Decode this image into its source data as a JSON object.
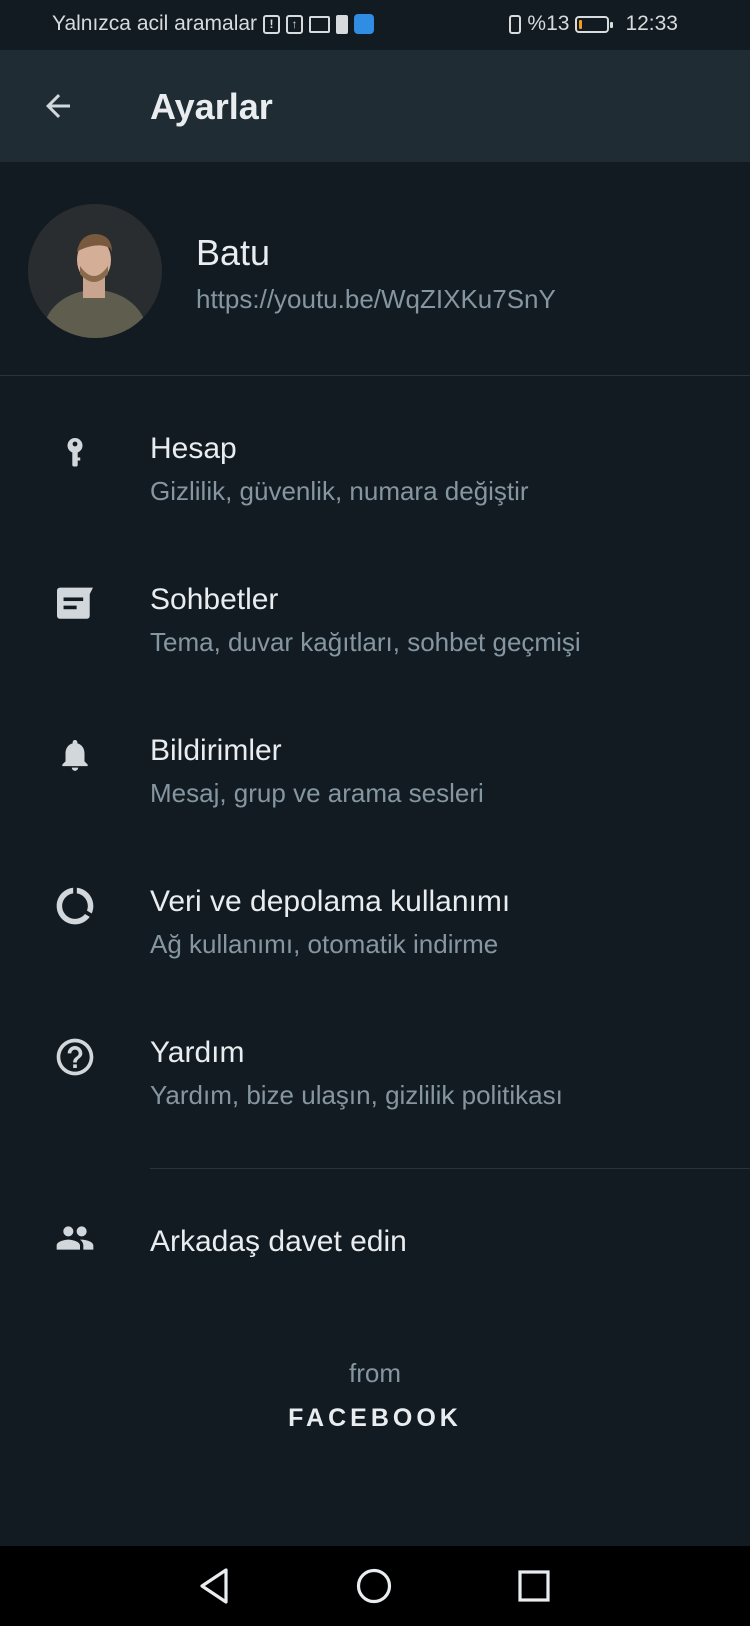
{
  "status_bar": {
    "carrier_text": "Yalnızca acil aramalar",
    "battery_text": "%13",
    "battery_level": 0.13,
    "time": "12:33",
    "icons": [
      "alert-icon",
      "upload-icon",
      "mail-icon",
      "battery-saver-icon",
      "app-notification-icon",
      "vibrate-icon",
      "battery-icon"
    ]
  },
  "header": {
    "title": "Ayarlar",
    "back_icon": "arrow-left-icon"
  },
  "profile": {
    "name": "Batu",
    "status": "https://youtu.be/WqZIXKu7SnY"
  },
  "menu": {
    "items": [
      {
        "icon": "key-icon",
        "title": "Hesap",
        "subtitle": "Gizlilik, güvenlik, numara değiştir"
      },
      {
        "icon": "chat-icon",
        "title": "Sohbetler",
        "subtitle": "Tema, duvar kağıtları, sohbet geçmişi"
      },
      {
        "icon": "bell-icon",
        "title": "Bildirimler",
        "subtitle": "Mesaj, grup ve arama sesleri"
      },
      {
        "icon": "data-usage-icon",
        "title": "Veri ve depolama kullanımı",
        "subtitle": "Ağ kullanımı, otomatik indirme"
      },
      {
        "icon": "help-icon",
        "title": "Yardım",
        "subtitle": "Yardım, bize ulaşın, gizlilik politikası"
      }
    ],
    "invite": {
      "icon": "people-icon",
      "label": "Arkadaş davet edin"
    }
  },
  "footer": {
    "from": "from",
    "brand": "FACEBOOK"
  },
  "colors": {
    "background": "#121b22",
    "app_bar": "#1f2c34",
    "primary_text": "#e9edef",
    "secondary_text": "#8696a0",
    "icon": "#d1d7db",
    "battery_low": "#f29b1c"
  }
}
